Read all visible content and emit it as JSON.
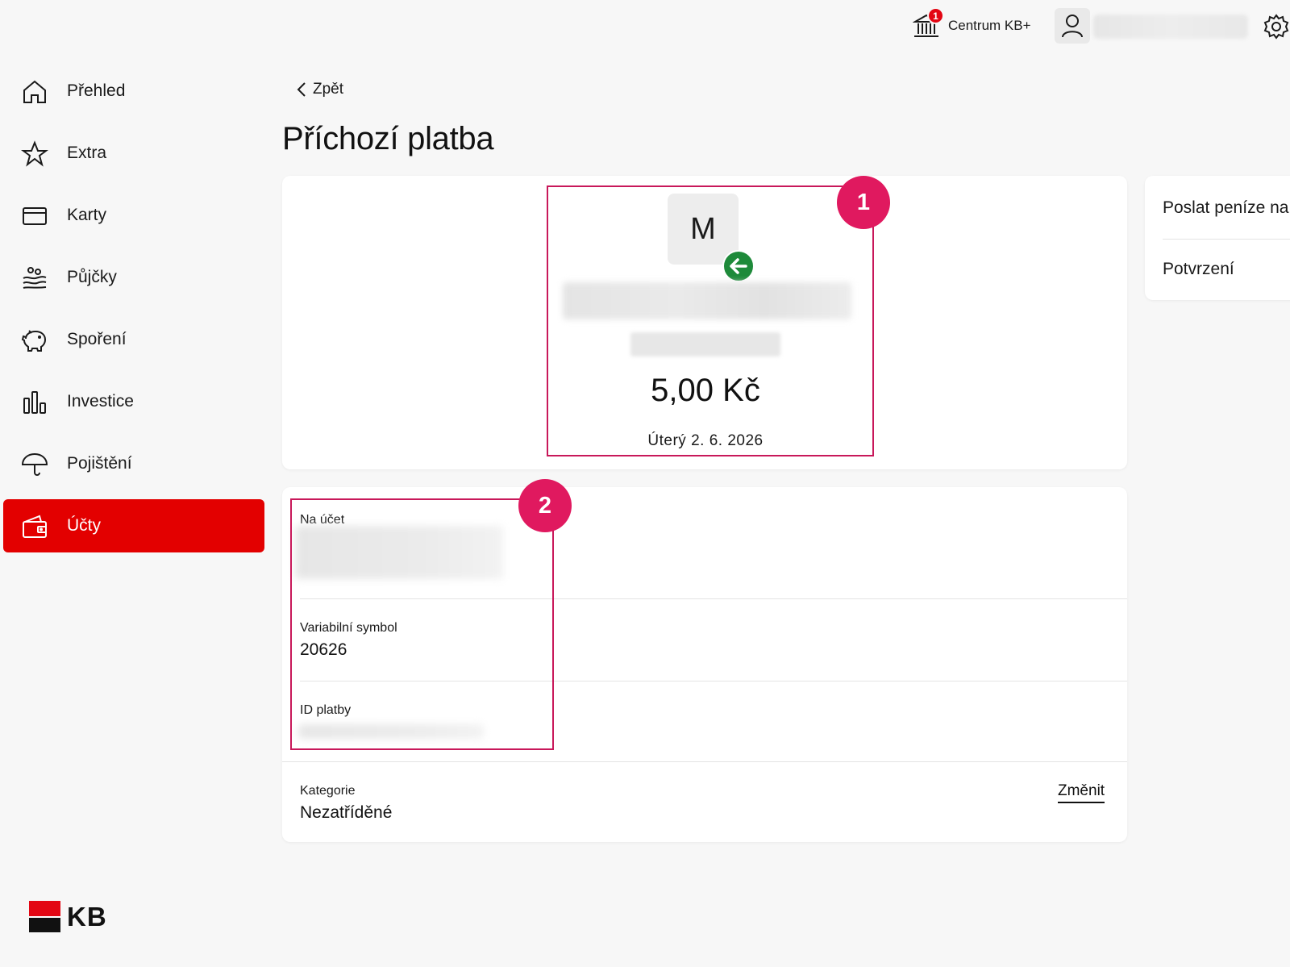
{
  "header": {
    "centrum_label": "Centrum KB+",
    "notification_count": "1",
    "accent_color": "#e30613"
  },
  "sidebar": {
    "items": [
      {
        "label": "Přehled",
        "icon": "home-icon"
      },
      {
        "label": "Extra",
        "icon": "star-icon"
      },
      {
        "label": "Karty",
        "icon": "card-icon"
      },
      {
        "label": "Půjčky",
        "icon": "loan-icon"
      },
      {
        "label": "Spoření",
        "icon": "piggy-bank-icon"
      },
      {
        "label": "Investice",
        "icon": "bar-chart-icon"
      },
      {
        "label": "Pojištění",
        "icon": "umbrella-icon"
      },
      {
        "label": "Účty",
        "icon": "wallet-icon",
        "active": true
      }
    ],
    "logo_text": "KB"
  },
  "main": {
    "back_label": "Zpět",
    "title": "Příchozí platba",
    "payment": {
      "avatar_letter": "M",
      "amount": "5,00 Kč",
      "date": "Úterý 2. 6. 2026"
    },
    "details": {
      "account_label": "Na účet",
      "variable_symbol_label": "Variabilní symbol",
      "variable_symbol_value": "20626",
      "payment_id_label": "ID platby",
      "category_label": "Kategorie",
      "category_value": "Nezatříděné",
      "change_label": "Změnit"
    },
    "annotations": [
      "1",
      "2"
    ]
  },
  "actions": {
    "items": [
      "Poslat peníze na",
      "Potvrzení"
    ]
  }
}
